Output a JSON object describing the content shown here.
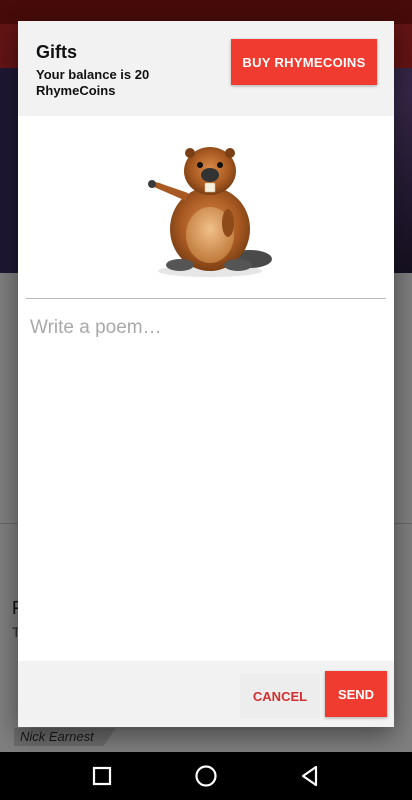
{
  "dialog": {
    "title": "Gifts",
    "balance": "Your balance is 20 RhymeCoins",
    "buy_label": "BUY RHYMECOINS",
    "gift_icon": "beaver-mascot-image",
    "poem_placeholder": "Write a poem…",
    "poem_value": "",
    "cancel_label": "CANCEL",
    "send_label": "SEND"
  },
  "background": {
    "letter_1": "F",
    "letter_2": "T",
    "author": "Nick Earnest"
  },
  "navigation": {
    "icons": [
      "recents-square-icon",
      "home-circle-icon",
      "back-triangle-icon"
    ]
  },
  "colors": {
    "accent": "#ef3b30",
    "toolbar": "#c62828",
    "status_bar": "#8e1612",
    "cancel_text": "#d32f2f"
  }
}
